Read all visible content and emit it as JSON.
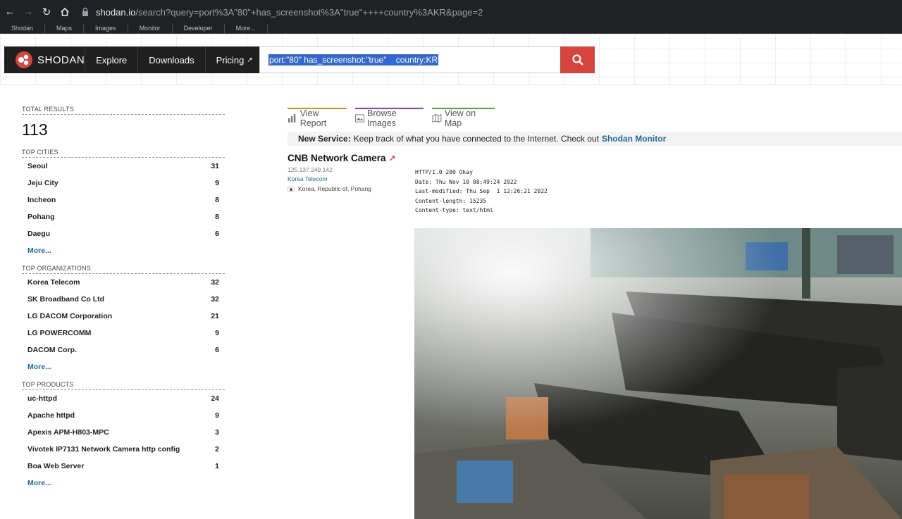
{
  "browser": {
    "url_host": "shodan.io",
    "url_rest": "/search?query=port%3A\"80\"+has_screenshot%3A\"true\"++++country%3AKR&page=2",
    "bookmarks": [
      "Shodan",
      "Maps",
      "Images",
      "Monitor",
      "Developer",
      "More..."
    ]
  },
  "header": {
    "brand": "Shodan",
    "nav": [
      {
        "label": "Explore"
      },
      {
        "label": "Downloads"
      },
      {
        "label": "Pricing"
      }
    ],
    "search_value": "port:\"80\" has_screenshot:\"true\"    country:KR"
  },
  "sidebar": {
    "total_title": "Total Results",
    "total": "113",
    "cities_title": "Top Cities",
    "cities": [
      {
        "name": "Seoul",
        "count": "31"
      },
      {
        "name": "Jeju City",
        "count": "9"
      },
      {
        "name": "Incheon",
        "count": "8"
      },
      {
        "name": "Pohang",
        "count": "8"
      },
      {
        "name": "Daegu",
        "count": "6"
      }
    ],
    "orgs_title": "Top Organizations",
    "orgs": [
      {
        "name": "Korea Telecom",
        "count": "32"
      },
      {
        "name": "SK Broadband Co Ltd",
        "count": "32"
      },
      {
        "name": "LG DACOM Corporation",
        "count": "21"
      },
      {
        "name": "LG POWERCOMM",
        "count": "9"
      },
      {
        "name": "DACOM Corp.",
        "count": "6"
      }
    ],
    "products_title": "Top Products",
    "products": [
      {
        "name": "uc-httpd",
        "count": "24"
      },
      {
        "name": "Apache httpd",
        "count": "9"
      },
      {
        "name": "Apexis APM-H803-MPC",
        "count": "3"
      },
      {
        "name": "Vivotek IP7131 Network Camera http config",
        "count": "2"
      },
      {
        "name": "Boa Web Server",
        "count": "1"
      }
    ],
    "more": "More..."
  },
  "tabs": {
    "report": "View Report",
    "images": "Browse Images",
    "map": "View on Map"
  },
  "notice": {
    "label": "New Service:",
    "text": "Keep track of what you have connected to the Internet. Check out",
    "link": "Shodan Monitor"
  },
  "result": {
    "title": "CNB Network Camera",
    "ip": "125.137.249.142",
    "org": "Korea Telecom",
    "location": "Korea, Republic of, Pohang",
    "banner": "HTTP/1.0 200 Okay\nDate: Thu Nov 10 08:49:24 2022\nLast-modified: Thu Sep  1 12:26:21 2022\nContent-length: 15235\nContent-type: text/html"
  }
}
